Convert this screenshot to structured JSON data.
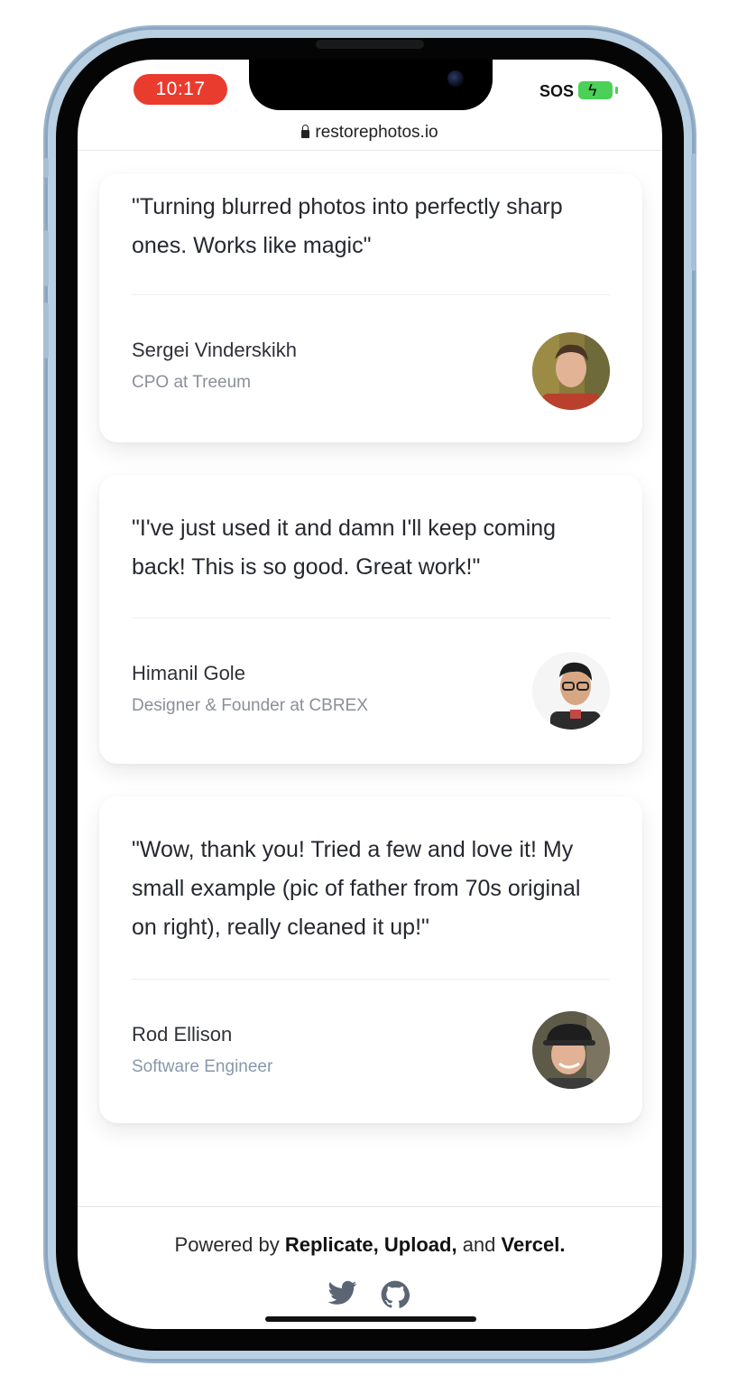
{
  "status_bar": {
    "time": "10:17",
    "sos": "SOS"
  },
  "browser": {
    "url": "restorephotos.io"
  },
  "testimonials": [
    {
      "quote": "\"Turning blurred photos into perfectly sharp ones. Works like magic\"",
      "name": "Sergei Vinderskikh",
      "role": "CPO at Treeum"
    },
    {
      "quote": "\"I've just used it and damn I'll keep coming back! This is so good. Great work!\"",
      "name": "Himanil Gole",
      "role": "Designer & Founder at CBREX"
    },
    {
      "quote": "\"Wow, thank you! Tried a few and love it! My small example (pic of father from 70s original on right), really cleaned it up!\"",
      "name": "Rod Ellison",
      "role": "Software Engineer"
    }
  ],
  "footer": {
    "prefix": "Powered by",
    "link1": "Replicate,",
    "link2": "Upload,",
    "conj": "and",
    "link3": "Vercel.",
    "icons": [
      "twitter-icon",
      "github-icon"
    ]
  },
  "colors": {
    "accent_red": "#ea3b2f",
    "battery_green": "#4bd157"
  }
}
